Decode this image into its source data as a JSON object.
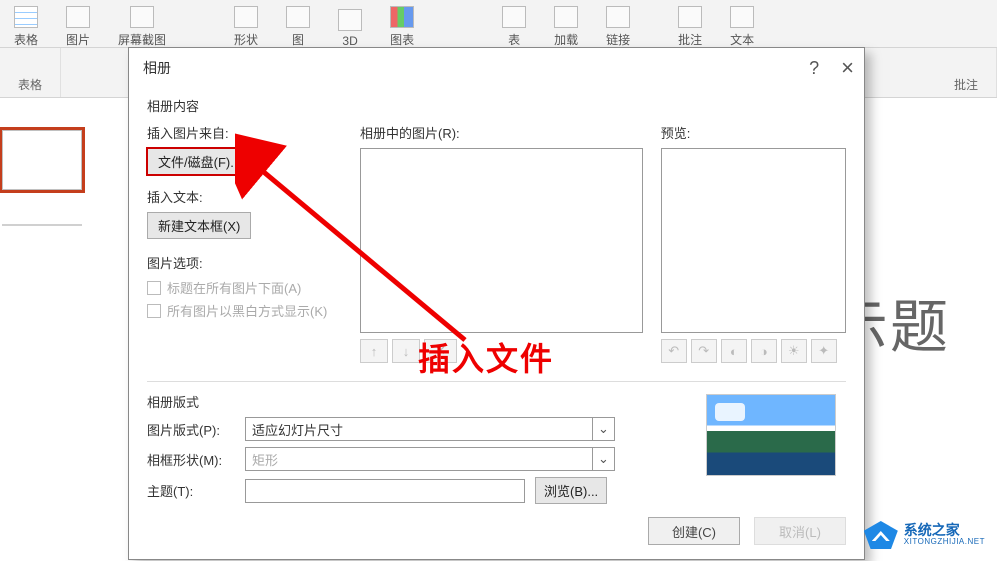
{
  "ribbon": {
    "items": [
      {
        "label": "表格"
      },
      {
        "label": "图片"
      },
      {
        "label": "屏幕截图"
      },
      {
        "label": "形状"
      },
      {
        "label": "图"
      },
      {
        "label": "3D"
      },
      {
        "label": "图表"
      },
      {
        "label": "表"
      },
      {
        "label": "加载"
      },
      {
        "label": "链接"
      },
      {
        "label": "批注"
      },
      {
        "label": "文本"
      }
    ],
    "groups": [
      "表格",
      "批注"
    ]
  },
  "slide": {
    "title_placeholder": "示题"
  },
  "dialog": {
    "title": "相册",
    "help": "?",
    "close": "×",
    "section_content": "相册内容",
    "insert_from_label": "插入图片来自:",
    "file_disk_btn": "文件/磁盘(F)...",
    "insert_text_label": "插入文本:",
    "new_textbox_btn": "新建文本框(X)",
    "options_label": "图片选项:",
    "opt_caption": "标题在所有图片下面(A)",
    "opt_bw": "所有图片以黑白方式显示(K)",
    "pictures_in_album_label": "相册中的图片(R):",
    "preview_label": "预览:",
    "reorder_up": "↑",
    "reorder_down": "↓",
    "remove": "✕",
    "img_tools": [
      "↶",
      "↷",
      "◐",
      "◑",
      "☀",
      "✦"
    ],
    "section_layout": "相册版式",
    "pic_layout_label": "图片版式(P):",
    "pic_layout_value": "适应幻灯片尺寸",
    "frame_shape_label": "相框形状(M):",
    "frame_shape_value": "矩形",
    "theme_label": "主题(T):",
    "browse_btn": "浏览(B)...",
    "create_btn": "创建(C)",
    "cancel_btn": "取消(L)"
  },
  "annotation": {
    "text": "插入文件"
  },
  "watermark": {
    "zh": "系统之家",
    "en": "XITONGZHIJIA.NET"
  }
}
